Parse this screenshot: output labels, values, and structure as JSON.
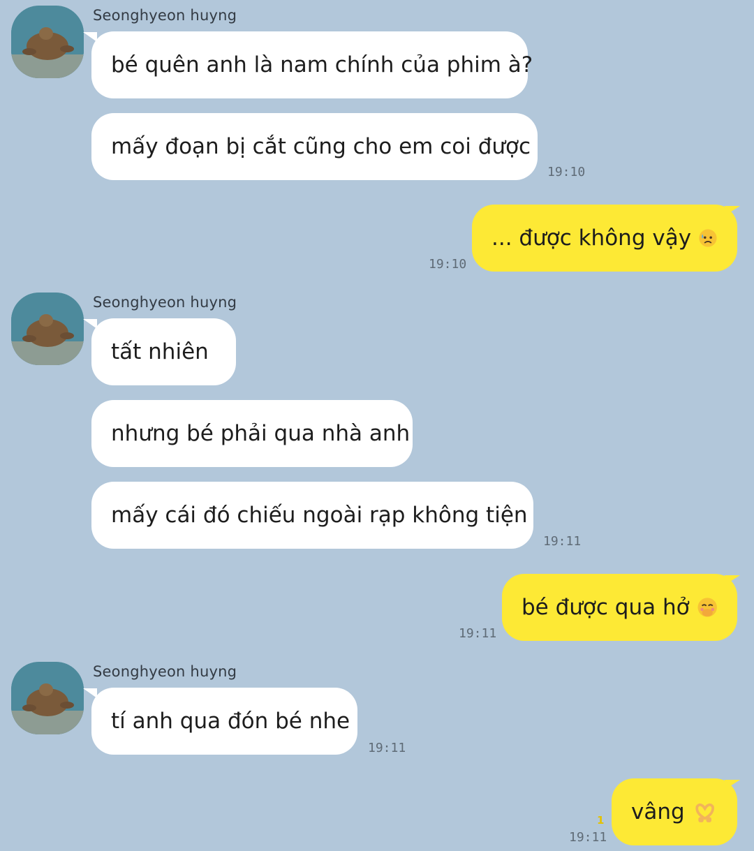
{
  "sender_name": "Seonghyeon huyng",
  "messages": {
    "m1": "bé quên anh là nam chính của phim à?",
    "m2": "mấy đoạn bị cắt cũng cho em coi được",
    "m3": "... được không vậy",
    "m4": "tất nhiên",
    "m5": "nhưng bé phải qua nhà anh",
    "m6": "mấy cái đó chiếu ngoài rạp không tiện",
    "m7": "bé được qua hở",
    "m8": "tí anh qua đón bé nhe",
    "m9": "vâng"
  },
  "times": {
    "t1": "19:10",
    "t2": "19:10",
    "t3": "19:11",
    "t4": "19:11",
    "t5": "19:11",
    "t6": "19:11"
  },
  "unread_count": "1",
  "icons": {
    "m3": "sad-sweat-emoji",
    "m7": "hand-over-mouth-emoji",
    "m9": "heart-hands-emoji"
  },
  "colors": {
    "background": "#b2c7da",
    "incoming_bubble": "#ffffff",
    "outgoing_bubble": "#fde935"
  }
}
